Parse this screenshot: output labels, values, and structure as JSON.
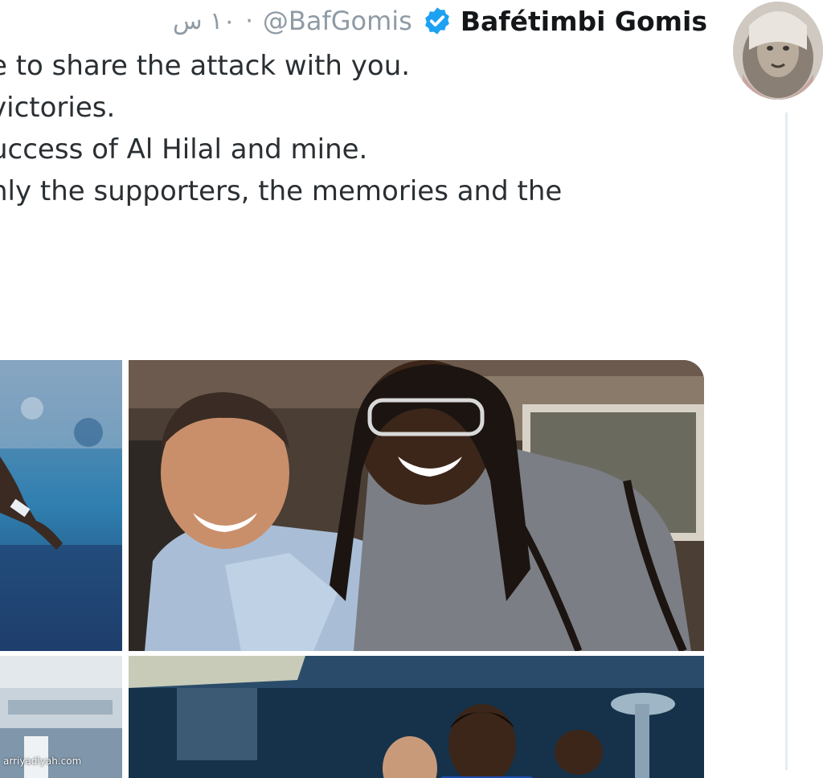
{
  "tweet": {
    "author_name": "Bafétimbi Gomis",
    "handle": "@BafGomis",
    "time": "١٠ س",
    "separator": "·",
    "lines": [
      "e to share the attack with you.",
      "victories.",
      "uccess of Al Hilal and mine.",
      "nly the supporters, the memories and the"
    ],
    "verified_icon": "verified-badge-icon",
    "accent_color": "#1da1f2"
  },
  "media": {
    "photos": [
      "photo-player-celebrating",
      "photo-two-men-laughing",
      "photo-stadium",
      "photo-team-celebrating"
    ]
  },
  "watermark": "arriyadiyah.com"
}
